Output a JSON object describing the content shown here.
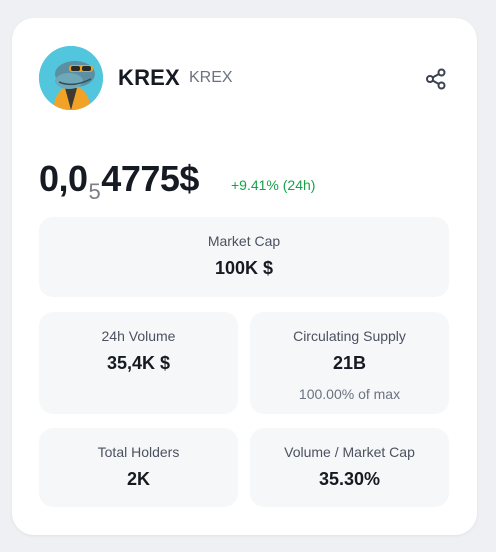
{
  "token": {
    "name": "KREX",
    "ticker": "KREX",
    "avatar_icon": "lizard-avatar-icon"
  },
  "actions": {
    "share_icon": "share-icon"
  },
  "price": {
    "prefix": "0,0",
    "zero_count": "5",
    "suffix": "4775$",
    "change": "+9.41% (24h)",
    "change_color": "#16a34a"
  },
  "stats": {
    "market_cap": {
      "label": "Market Cap",
      "value": "100K $"
    },
    "volume_24h": {
      "label": "24h Volume",
      "value": "35,4K $"
    },
    "circulating_supply": {
      "label": "Circulating Supply",
      "value": "21B",
      "sub": "100.00% of max"
    },
    "total_holders": {
      "label": "Total Holders",
      "value": "2K"
    },
    "volume_market_cap": {
      "label": "Volume / Market Cap",
      "value": "35.30%"
    }
  }
}
